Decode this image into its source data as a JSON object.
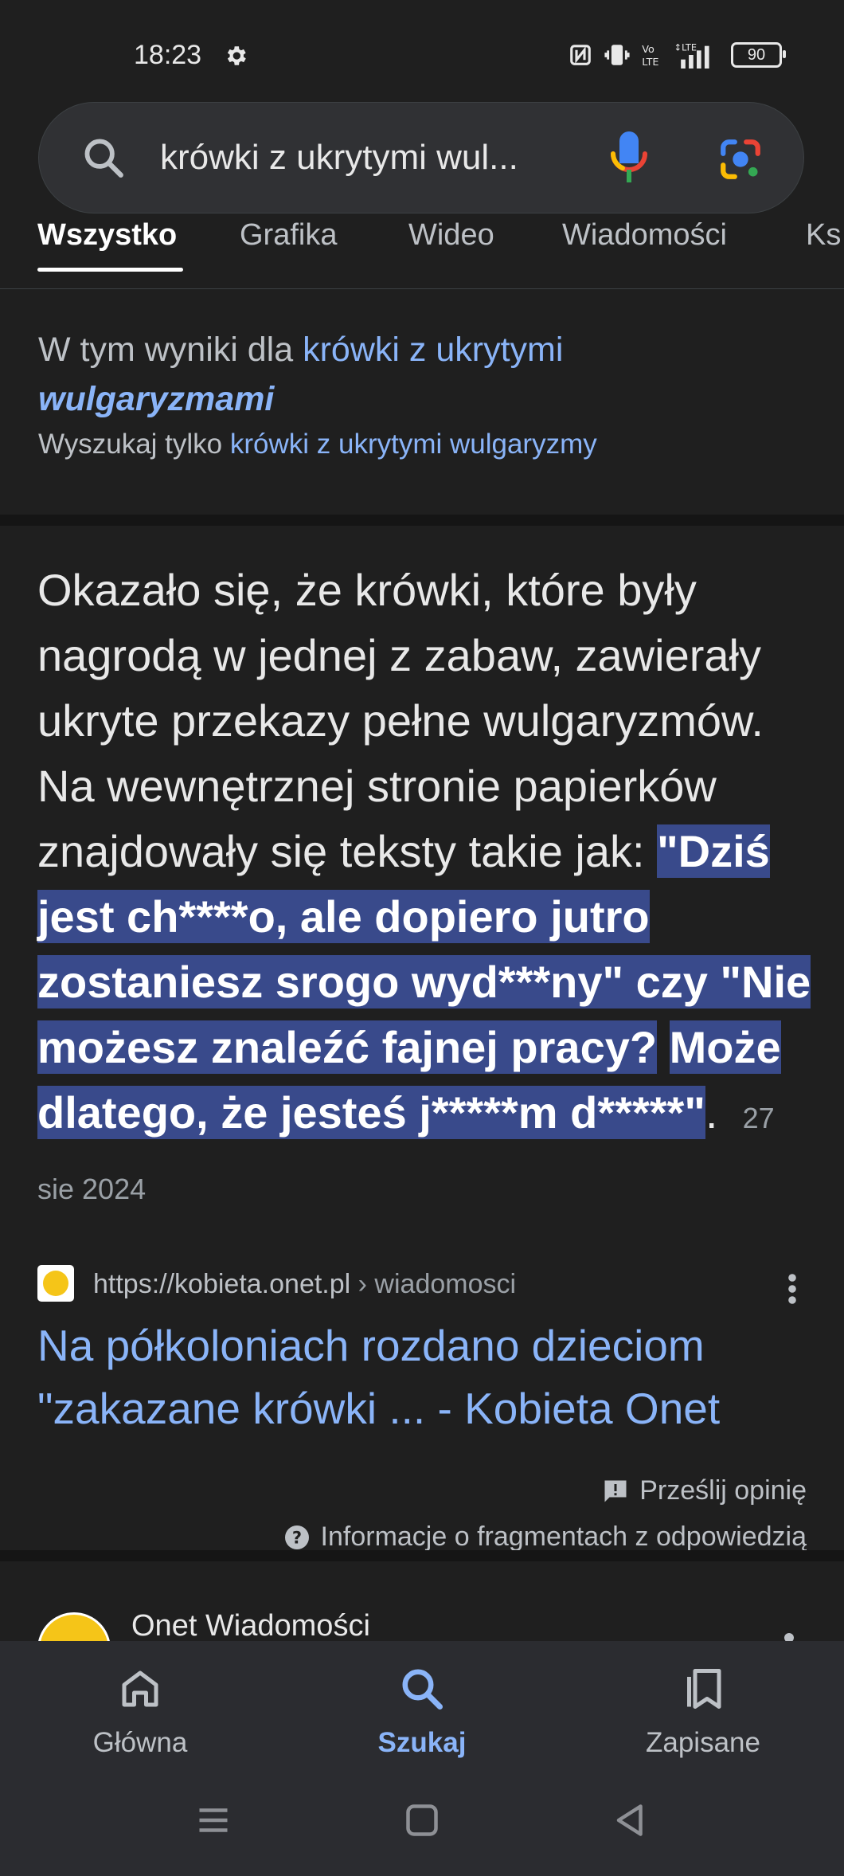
{
  "status_bar": {
    "time": "18:23",
    "battery": "90"
  },
  "search": {
    "query": "krówki z ukrytymi wul..."
  },
  "tabs": [
    {
      "label": "Wszystko",
      "active": true
    },
    {
      "label": "Grafika"
    },
    {
      "label": "Wideo"
    },
    {
      "label": "Wiadomości"
    },
    {
      "label": "Ks"
    }
  ],
  "spelling": {
    "prefix": "W tym wyniki dla ",
    "link_normal": "krówki z ukrytymi",
    "link_bold": "wulgaryzmami",
    "search_only_prefix": "Wyszukaj tylko ",
    "search_only_link": "krówki z ukrytymi wulgaryzmy"
  },
  "snippet": {
    "text_plain": "Okazało się, że krówki, które były nagrodą w jednej z zabaw, zawierały ukryte przekazy pełne wulgaryzmów. Na wewnętrznej stronie papierków znajdowały się teksty takie jak: ",
    "text_hl1": "\"Dziś jest ch****o, ale dopiero jutro zostaniesz srogo wyd***ny\" czy \"Nie możesz znaleźć fajnej pracy?",
    "text_hl2": "Może dlatego, że jesteś j*****m d*****\"",
    "text_end": ".",
    "date": "27 sie 2024"
  },
  "result": {
    "url": "https://kobieta.onet.pl",
    "breadcrumb": " › wiadomosci",
    "title": "Na półkoloniach rozdano dzieciom \"zakazane krówki ... - Kobieta Onet"
  },
  "footer_links": {
    "feedback": "Prześlij opinię",
    "about": "Informacje o fragmentach z odpowiedzią"
  },
  "next_result": {
    "source": "Onet Wiadomości"
  },
  "bottom_nav": [
    {
      "label": "Główna"
    },
    {
      "label": "Szukaj",
      "active": true
    },
    {
      "label": "Zapisane"
    }
  ],
  "colors": {
    "link": "#8ab4f8",
    "highlight": "#394a8b",
    "background": "#1f1f1f"
  }
}
